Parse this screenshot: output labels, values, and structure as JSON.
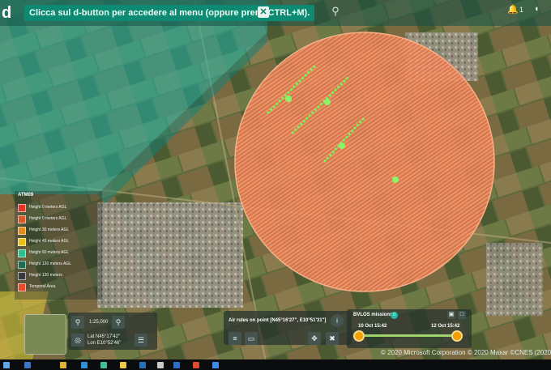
{
  "header": {
    "logo_letter": "d",
    "hint_text": "Clicca sul d-button per accedere al menu (oppure premi CTRL+M).",
    "close_label": "✕",
    "search_icon": "search-icon",
    "notification_count": "1"
  },
  "legend": {
    "title": "ATM09",
    "items": [
      {
        "label": "Height 0 meters AGL",
        "color": "#e0342a"
      },
      {
        "label": "Height 0 meters AGL",
        "color": "#d65a28"
      },
      {
        "label": "Height 30 meters AGL",
        "color": "#e38a1f"
      },
      {
        "label": "Height 45 meters AGL",
        "color": "#e6c21a"
      },
      {
        "label": "Height 60 meters AGL",
        "color": "#2fbf8f"
      },
      {
        "label": "Height 120 meters AGL",
        "color": "#1e6d52"
      },
      {
        "label": "Height 120 meters",
        "color": "#3a3a3a"
      },
      {
        "label": "Temporal Area",
        "color": "#e34b2b"
      }
    ]
  },
  "map_controls": {
    "scale": "1:25,000",
    "lat": "Lat  N45°17'42\"",
    "lon": "Lon E10°52'46\"",
    "zoom_in_icon": "zoom-in-icon",
    "zoom_out_icon": "zoom-out-icon",
    "target_icon": "target-icon",
    "layers_icon": "layers-icon"
  },
  "air_rules": {
    "text": "Air rules on point [N45°16'27\", E10°51'31\"]"
  },
  "bvlos": {
    "title": "BVLOS missions",
    "badge": "0",
    "start_label": "10 Oct 15:42",
    "end_label": "12 Oct 15:42"
  },
  "footer": {
    "copyright": "© 2020 Microsoft Corporation © 2020 Maxar ©CNES (2020) Di"
  },
  "colors": {
    "hint_bg": "#0f8a72",
    "zone_orange": "#ee7a4a",
    "teal_area": "#1fb3a8",
    "timeline": "#9fd46a"
  }
}
